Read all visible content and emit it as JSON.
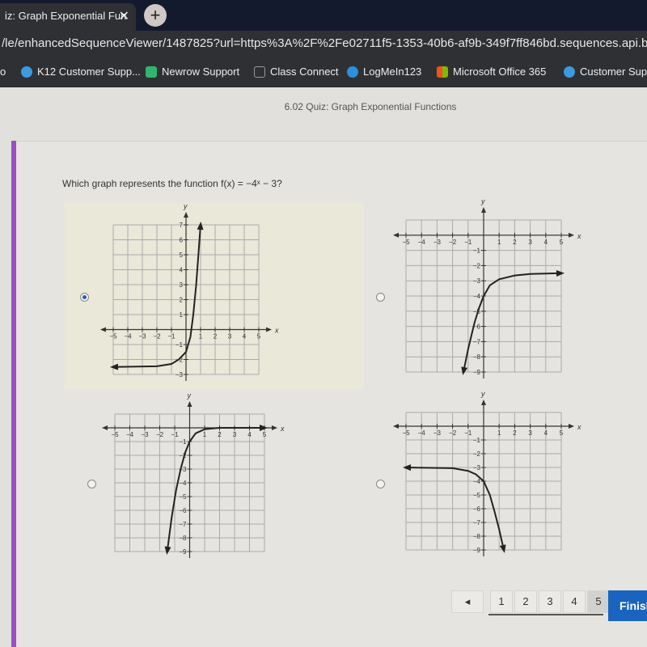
{
  "browser": {
    "tab_title": "iz: Graph Exponential Fun",
    "url": "/le/enhancedSequenceViewer/1487825?url=https%3A%2F%2Fe02711f5-1353-40b6-af9b-349f7ff846bd.sequences.api.brightsp",
    "bookmarks": [
      {
        "label": "o",
        "color": ""
      },
      {
        "label": "K12 Customer Supp...",
        "color": "#3a9be0"
      },
      {
        "label": "Newrow Support",
        "color": "#2fb56f"
      },
      {
        "label": "Class Connect",
        "color": "#555"
      },
      {
        "label": "LogMeIn123",
        "color": "#2d8fe0"
      },
      {
        "label": "Microsoft Office 365",
        "color": "#f25022"
      },
      {
        "label": "Customer Sup",
        "color": "#3a9be0"
      }
    ]
  },
  "quiz": {
    "title": "6.02 Quiz: Graph Exponential Functions",
    "question": "Which graph represents the function f(x) = −4ˣ − 3?",
    "selected_option": 0
  },
  "graphs": [
    {
      "xlim": [
        -5,
        5
      ],
      "ylim": [
        -3,
        7
      ],
      "x_ticks": [
        "-5",
        "-4",
        "-3",
        "-2",
        "-1",
        "1",
        "2",
        "3",
        "4",
        "5"
      ],
      "y_ticks": [
        "7",
        "6",
        "5",
        "4",
        "3",
        "2",
        "1",
        "-1",
        "-2",
        "-3"
      ],
      "x_label": "x",
      "y_label": "y",
      "curve": [
        [
          -5,
          -2.5
        ],
        [
          -2,
          -2.45
        ],
        [
          -1,
          -2.3
        ],
        [
          -0.5,
          -2
        ],
        [
          0,
          -1.5
        ],
        [
          0.3,
          -0.5
        ],
        [
          0.5,
          1
        ],
        [
          0.7,
          3
        ],
        [
          0.85,
          5
        ],
        [
          1,
          7
        ]
      ],
      "arrows": [
        "start",
        "end"
      ]
    },
    {
      "xlim": [
        -5,
        5
      ],
      "ylim": [
        -9,
        1
      ],
      "x_ticks": [
        "-5",
        "-4",
        "-3",
        "-2",
        "-1",
        "1",
        "2",
        "3",
        "4",
        "5"
      ],
      "y_ticks": [
        "-1",
        "-2",
        "-3",
        "-4",
        "-5",
        "-6",
        "-7",
        "-8",
        "-9"
      ],
      "x_label": "x",
      "y_label": "y",
      "curve": [
        [
          -1.3,
          -9
        ],
        [
          -1,
          -7.5
        ],
        [
          -0.6,
          -5.8
        ],
        [
          -0.3,
          -4.8
        ],
        [
          0,
          -4
        ],
        [
          0.4,
          -3.3
        ],
        [
          1,
          -2.9
        ],
        [
          2,
          -2.65
        ],
        [
          3,
          -2.55
        ],
        [
          5,
          -2.5
        ]
      ],
      "arrows": [
        "start",
        "end"
      ]
    },
    {
      "xlim": [
        -5,
        5
      ],
      "ylim": [
        -9,
        1
      ],
      "x_ticks": [
        "-5",
        "-4",
        "-3",
        "-2",
        "-1",
        "1",
        "2",
        "3",
        "4",
        "5"
      ],
      "y_ticks": [
        "-1",
        "-2",
        "-3",
        "-4",
        "-5",
        "-6",
        "-7",
        "-8",
        "-9"
      ],
      "x_label": "x",
      "y_label": "y",
      "curve": [
        [
          -1.5,
          -9
        ],
        [
          -1.2,
          -6.5
        ],
        [
          -0.9,
          -4.5
        ],
        [
          -0.6,
          -3
        ],
        [
          -0.3,
          -1.8
        ],
        [
          0,
          -1
        ],
        [
          0.4,
          -0.4
        ],
        [
          1,
          -0.1
        ],
        [
          2,
          0
        ],
        [
          5,
          0
        ]
      ],
      "arrows": [
        "start",
        "end"
      ]
    },
    {
      "xlim": [
        -5,
        5
      ],
      "ylim": [
        -9,
        1
      ],
      "x_ticks": [
        "-5",
        "-4",
        "-3",
        "-2",
        "-1",
        "1",
        "2",
        "3",
        "4",
        "5"
      ],
      "y_ticks": [
        "-1",
        "-2",
        "-3",
        "-4",
        "-5",
        "-6",
        "-7",
        "-8",
        "-9"
      ],
      "x_label": "x",
      "y_label": "y",
      "curve": [
        [
          -5,
          -3
        ],
        [
          -2,
          -3.05
        ],
        [
          -1,
          -3.25
        ],
        [
          -0.5,
          -3.5
        ],
        [
          0,
          -4
        ],
        [
          0.4,
          -5
        ],
        [
          0.7,
          -6.2
        ],
        [
          1,
          -7.5
        ],
        [
          1.3,
          -9
        ]
      ],
      "arrows": [
        "start",
        "end"
      ]
    }
  ],
  "pagination": {
    "prev_label": "◂",
    "pages": [
      "1",
      "2",
      "3",
      "4",
      "5"
    ],
    "current_page": "5",
    "finish_label": "Finish"
  }
}
